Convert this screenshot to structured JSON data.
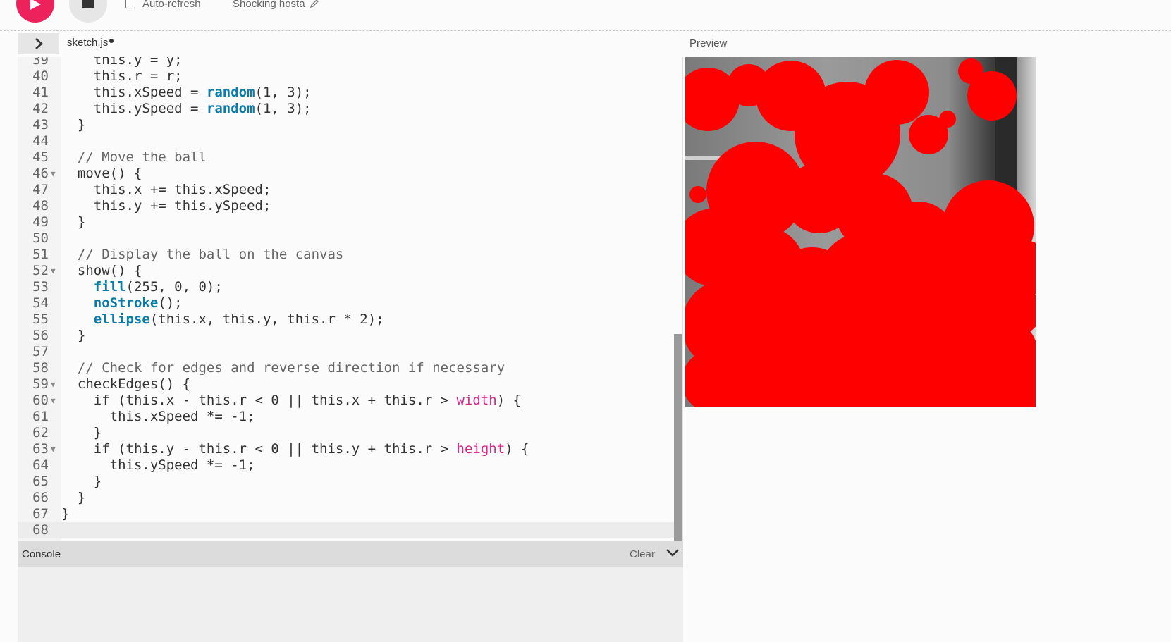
{
  "toolbar": {
    "auto_refresh_label": "Auto-refresh",
    "auto_refresh_checked": false,
    "sketch_name": "Shocking hosta"
  },
  "editor": {
    "file_tab": "sketch.js",
    "unsaved": true,
    "lines": [
      {
        "num": "39",
        "fold": false,
        "tokens": [
          {
            "t": "    this.y = y;",
            "c": ""
          }
        ]
      },
      {
        "num": "40",
        "fold": false,
        "tokens": [
          {
            "t": "    this.r = r;",
            "c": ""
          }
        ]
      },
      {
        "num": "41",
        "fold": false,
        "tokens": [
          {
            "t": "    this.xSpeed = ",
            "c": ""
          },
          {
            "t": "random",
            "c": "fn"
          },
          {
            "t": "(1, 3);",
            "c": ""
          }
        ]
      },
      {
        "num": "42",
        "fold": false,
        "tokens": [
          {
            "t": "    this.ySpeed = ",
            "c": ""
          },
          {
            "t": "random",
            "c": "fn"
          },
          {
            "t": "(1, 3);",
            "c": ""
          }
        ]
      },
      {
        "num": "43",
        "fold": false,
        "tokens": [
          {
            "t": "  }",
            "c": ""
          }
        ]
      },
      {
        "num": "44",
        "fold": false,
        "tokens": [
          {
            "t": "",
            "c": ""
          }
        ]
      },
      {
        "num": "45",
        "fold": false,
        "tokens": [
          {
            "t": "  // Move the ball",
            "c": "comment"
          }
        ]
      },
      {
        "num": "46",
        "fold": true,
        "tokens": [
          {
            "t": "  move() {",
            "c": ""
          }
        ]
      },
      {
        "num": "47",
        "fold": false,
        "tokens": [
          {
            "t": "    this.x += this.xSpeed;",
            "c": ""
          }
        ]
      },
      {
        "num": "48",
        "fold": false,
        "tokens": [
          {
            "t": "    this.y += this.ySpeed;",
            "c": ""
          }
        ]
      },
      {
        "num": "49",
        "fold": false,
        "tokens": [
          {
            "t": "  }",
            "c": ""
          }
        ]
      },
      {
        "num": "50",
        "fold": false,
        "tokens": [
          {
            "t": "",
            "c": ""
          }
        ]
      },
      {
        "num": "51",
        "fold": false,
        "tokens": [
          {
            "t": "  // Display the ball on the canvas",
            "c": "comment"
          }
        ]
      },
      {
        "num": "52",
        "fold": true,
        "tokens": [
          {
            "t": "  show() {",
            "c": ""
          }
        ]
      },
      {
        "num": "53",
        "fold": false,
        "tokens": [
          {
            "t": "    ",
            "c": ""
          },
          {
            "t": "fill",
            "c": "fn"
          },
          {
            "t": "(255, 0, 0);",
            "c": ""
          }
        ]
      },
      {
        "num": "54",
        "fold": false,
        "tokens": [
          {
            "t": "    ",
            "c": ""
          },
          {
            "t": "noStroke",
            "c": "fn"
          },
          {
            "t": "();",
            "c": ""
          }
        ]
      },
      {
        "num": "55",
        "fold": false,
        "tokens": [
          {
            "t": "    ",
            "c": ""
          },
          {
            "t": "ellipse",
            "c": "fn"
          },
          {
            "t": "(this.x, this.y, this.r * 2);",
            "c": ""
          }
        ]
      },
      {
        "num": "56",
        "fold": false,
        "tokens": [
          {
            "t": "  }",
            "c": ""
          }
        ]
      },
      {
        "num": "57",
        "fold": false,
        "tokens": [
          {
            "t": "",
            "c": ""
          }
        ]
      },
      {
        "num": "58",
        "fold": false,
        "tokens": [
          {
            "t": "  // Check for edges and reverse direction if necessary",
            "c": "comment"
          }
        ]
      },
      {
        "num": "59",
        "fold": true,
        "tokens": [
          {
            "t": "  checkEdges() {",
            "c": ""
          }
        ]
      },
      {
        "num": "60",
        "fold": true,
        "tokens": [
          {
            "t": "    if (this.x - this.r < 0 || this.x + this.r > ",
            "c": ""
          },
          {
            "t": "width",
            "c": "const"
          },
          {
            "t": ") {",
            "c": ""
          }
        ]
      },
      {
        "num": "61",
        "fold": false,
        "tokens": [
          {
            "t": "      this.xSpeed *= -1;",
            "c": ""
          }
        ]
      },
      {
        "num": "62",
        "fold": false,
        "tokens": [
          {
            "t": "    }",
            "c": ""
          }
        ]
      },
      {
        "num": "63",
        "fold": true,
        "tokens": [
          {
            "t": "    if (this.y - this.r < 0 || this.y + this.r > ",
            "c": ""
          },
          {
            "t": "height",
            "c": "const"
          },
          {
            "t": ") {",
            "c": ""
          }
        ]
      },
      {
        "num": "64",
        "fold": false,
        "tokens": [
          {
            "t": "      this.ySpeed *= -1;",
            "c": ""
          }
        ]
      },
      {
        "num": "65",
        "fold": false,
        "tokens": [
          {
            "t": "    }",
            "c": ""
          }
        ]
      },
      {
        "num": "66",
        "fold": false,
        "tokens": [
          {
            "t": "  }",
            "c": ""
          }
        ]
      },
      {
        "num": "67",
        "fold": false,
        "tokens": [
          {
            "t": "}",
            "c": ""
          }
        ]
      },
      {
        "num": "68",
        "fold": false,
        "active": true,
        "tokens": [
          {
            "t": "",
            "c": ""
          }
        ]
      }
    ]
  },
  "console": {
    "title": "Console",
    "clear_label": "Clear"
  },
  "preview": {
    "label": "Preview",
    "fill_color": "#ff0000",
    "background": "grayscale-camera-feed"
  },
  "colors": {
    "accent": "#ed225d",
    "keyword_fn": "#0b7ca9",
    "constant": "#d52889"
  },
  "icons": {
    "play": "play-icon",
    "stop": "stop-icon",
    "toggle": "chevron-right-icon",
    "edit": "pencil-icon",
    "collapse": "chevron-down-icon"
  }
}
